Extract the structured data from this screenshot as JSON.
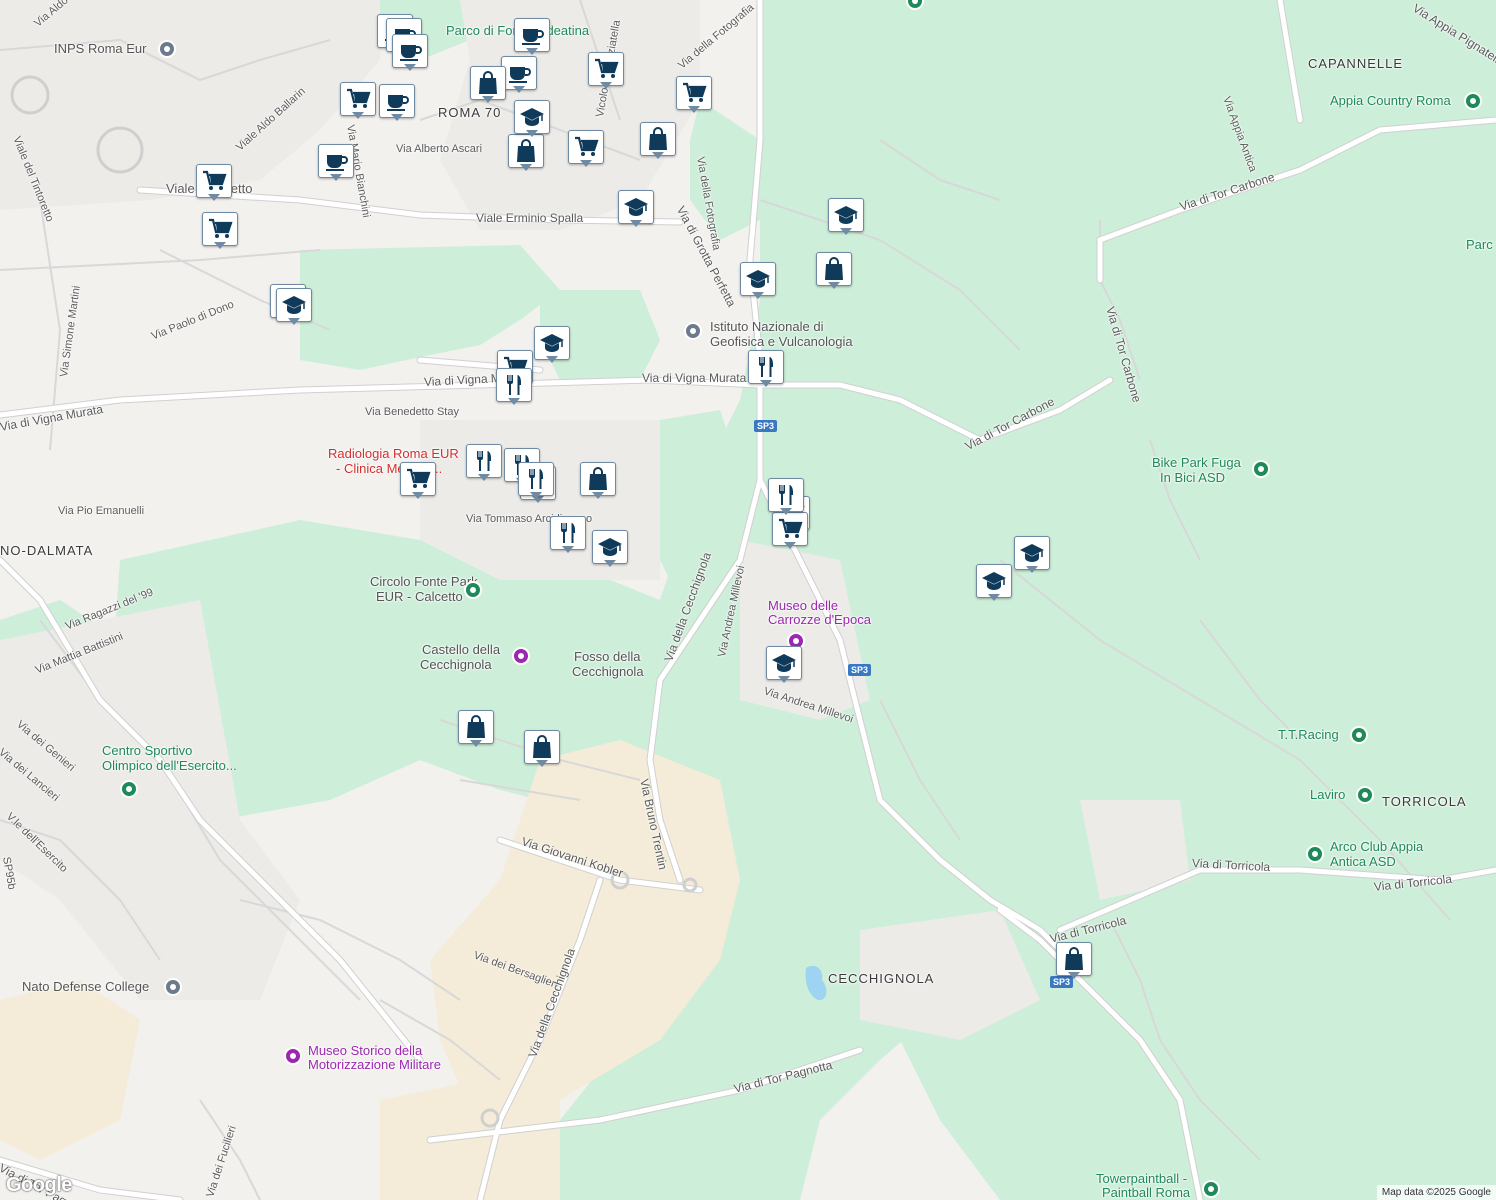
{
  "colors": {
    "park": "#cdeed9",
    "military_sand": "#f4ecd8",
    "road_major": "#ffffff",
    "road_outline": "#d4d4d4",
    "water": "#9fd3f2",
    "pin_fill": "#0f3a5a",
    "poi_green": "#1e8a5a",
    "poi_purple": "#9c27b0",
    "poi_red": "#d32f2f",
    "shield_blue": "#3a78c2"
  },
  "areas": [
    "ROMA 70",
    "CAPANNELLE",
    "TORRICOLA",
    "CECCHIGNOLA",
    "NO-DALMATA"
  ],
  "streets": [
    "Via Aldo",
    "Viale del Tintoretto",
    "Viale Aldo Ballarin",
    "Via Mario Bianchini",
    "Viale Tintoretto",
    "Via Alberto Ascari",
    "Viale Erminio Spalla",
    "Via della Fotografia",
    "Via della Fotografia",
    "Via di Grotta Perfetta",
    "Vicolo Annunziatella",
    "Via Simone Martini",
    "Via Paolo di Dono",
    "Via di Vigna Murata",
    "Via di Vigna Murata",
    "Via di Vigna Murata",
    "Via Benedetto Stay",
    "Via Pio Emanuelli",
    "Via Tommaso Arcidiacono",
    "Via Ragazzi del '99",
    "Via Mattia Battistini",
    "Via dei Genieri",
    "Via dei Lancieri",
    "V.le dell'Esercito",
    "Via della Cecchignola",
    "Via Andrea Millevoi",
    "Via Andrea Millevoi",
    "Via Bruno Trentin",
    "Via Giovanni Kobler",
    "Via dei Bersaglieri",
    "Via della Cecchignola",
    "Via dei Fucilieri",
    "Via di Tor Pagnotta",
    "Via di Tor Pagnotta",
    "Via di Tor Carbone",
    "Via di Tor Carbone",
    "Via di Tor Carbone",
    "Via Appia Antica",
    "Via Appia Pignatelli",
    "Via di Torricola",
    "Via di Torricola",
    "Via di Torricola"
  ],
  "places": {
    "inps": "INPS Roma Eur",
    "parco": "Parco di Fonte Ardeatina",
    "ingv_1": "Istituto Nazionale di",
    "ingv_2": "Geofisica e Vulcanologia",
    "radiologia_1": "Radiologia Roma EUR",
    "radiologia_2": "- Clinica Medical...",
    "circolo_1": "Circolo Fonte Park",
    "circolo_2": "EUR - Calcetto",
    "castello_1": "Castello della",
    "castello_2": "Cecchignola",
    "fosso_1": "Fosso della",
    "fosso_2": "Cecchignola",
    "museo_carrozze_1": "Museo delle",
    "museo_carrozze_2": "Carrozze d'Epoca",
    "centro_1": "Centro Sportivo",
    "centro_2": "Olimpico dell'Esercito...",
    "nato": "Nato Defense College",
    "museo_moto_1": "Museo Storico della",
    "museo_moto_2": "Motorizzazione Militare",
    "appia_country": "Appia Country Roma",
    "bike_1": "Bike Park Fuga",
    "bike_2": "In Bici ASD",
    "tt": "T.T.Racing",
    "laviro": "Laviro",
    "arco_1": "Arco Club Appia",
    "arco_2": "Antica ASD",
    "tower_1": "Towerpaintball -",
    "tower_2": "Paintball Roma",
    "parc": "Parc"
  },
  "route_shields": [
    "SP3",
    "SP3",
    "SP3",
    "SP95b"
  ],
  "map_pins": [
    {
      "icon": "coffee-icon"
    },
    {
      "icon": "coffee-icon"
    },
    {
      "icon": "coffee-icon"
    },
    {
      "icon": "coffee-icon"
    },
    {
      "icon": "coffee-icon"
    },
    {
      "icon": "coffee-icon"
    },
    {
      "icon": "coffee-icon"
    },
    {
      "icon": "cart-icon"
    },
    {
      "icon": "cart-icon"
    },
    {
      "icon": "cart-icon"
    },
    {
      "icon": "cart-icon"
    },
    {
      "icon": "cart-icon"
    },
    {
      "icon": "cart-icon"
    },
    {
      "icon": "cart-icon"
    },
    {
      "icon": "cart-icon"
    },
    {
      "icon": "cart-icon"
    },
    {
      "icon": "cart-icon"
    },
    {
      "icon": "cart-icon"
    },
    {
      "icon": "bag-icon"
    },
    {
      "icon": "bag-icon"
    },
    {
      "icon": "bag-icon"
    },
    {
      "icon": "bag-icon"
    },
    {
      "icon": "bag-icon"
    },
    {
      "icon": "bag-icon"
    },
    {
      "icon": "bag-icon"
    },
    {
      "icon": "bag-icon"
    },
    {
      "icon": "school-icon"
    },
    {
      "icon": "school-icon"
    },
    {
      "icon": "school-icon"
    },
    {
      "icon": "school-icon"
    },
    {
      "icon": "school-icon"
    },
    {
      "icon": "school-icon"
    },
    {
      "icon": "school-icon"
    },
    {
      "icon": "school-icon"
    },
    {
      "icon": "school-icon"
    },
    {
      "icon": "school-icon"
    },
    {
      "icon": "restaurant-icon"
    },
    {
      "icon": "restaurant-icon"
    },
    {
      "icon": "restaurant-icon"
    },
    {
      "icon": "restaurant-icon"
    },
    {
      "icon": "restaurant-icon"
    },
    {
      "icon": "restaurant-icon"
    },
    {
      "icon": "restaurant-icon"
    },
    {
      "icon": "restaurant-icon"
    }
  ],
  "attribution": "Map data ©2025 Google",
  "logo": "Google"
}
